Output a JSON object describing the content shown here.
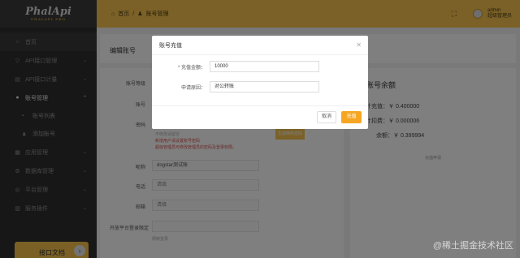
{
  "brand": {
    "logo": "PhalApi",
    "logo_sub": "PHALAPI PRO"
  },
  "sidebar": {
    "items": [
      {
        "label": "首页",
        "icon": "home-icon"
      },
      {
        "label": "API接口管理",
        "icon": "api-icon"
      },
      {
        "label": "API接口计量",
        "icon": "meter-icon"
      },
      {
        "label": "账号管理",
        "icon": "user-icon"
      },
      {
        "label": "账号列表",
        "icon": "list-icon"
      },
      {
        "label": "添加账号",
        "icon": "add-user-icon"
      },
      {
        "label": "应用管理",
        "icon": "app-icon"
      },
      {
        "label": "数据库管理",
        "icon": "database-icon"
      },
      {
        "label": "平台管理",
        "icon": "platform-icon"
      },
      {
        "label": "服务插件",
        "icon": "plugin-icon"
      }
    ],
    "doc_button": "接口文档"
  },
  "header": {
    "breadcrumb": [
      "首页",
      "账号管理"
    ],
    "user": "admin",
    "user_sub": "超级管理员"
  },
  "page": {
    "title": "编辑账号",
    "form": {
      "account_label": "账号等级",
      "id_label": "账号",
      "password_label": "密码",
      "password_hint": "不修改请留空",
      "password_warn1": "新增用户请设置账号密码",
      "password_warn2": "超级管理员可修改管理员的密码及登录权限。",
      "password_button": "生成随机密码",
      "nickname_label": "昵称",
      "nickname_value": "dogstar测试账",
      "phone_label": "电话",
      "phone_placeholder": "请填",
      "email_label": "邮箱",
      "email_placeholder": "请填",
      "login_perm_label": "开放平台登录限定",
      "login_perm_sub": "限制登录"
    },
    "balance": {
      "title": "账号余额",
      "recharge_total": "累计充值：￥ 0.400000",
      "deduct_total": "累计扣费：￥ 0.000006",
      "balance": "余额：￥ 0.399994",
      "detail_link": "充值申请"
    }
  },
  "modal": {
    "title": "账号充值",
    "amount_label": "* 充值金额：",
    "amount_value": "10000",
    "reason_label": "申请原因：",
    "reason_value": "对公转账",
    "cancel": "取消",
    "confirm": "充值"
  },
  "watermark": "@稀土掘金技术社区"
}
